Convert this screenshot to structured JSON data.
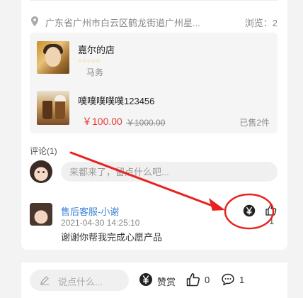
{
  "location": {
    "address": "广东省广州市白云区鹤龙街道广州星...",
    "views": "浏览：2"
  },
  "shop": {
    "name": "嘉尔的店",
    "rating_text": "☆☆☆☆☆",
    "subtitle": "马务"
  },
  "product": {
    "name": "噗噗噗噗噗123456",
    "price": "￥100.00",
    "original_price": "￥1000.00",
    "sold": "已售2件"
  },
  "comments": {
    "title": "评论(1)",
    "input_placeholder": "来都来了，留点什么吧...",
    "items": [
      {
        "author": "售后客服-小谢",
        "time": "2021-04-30 14:25:10",
        "text": "谢谢你帮我完成心愿产品",
        "likes": "1"
      }
    ]
  },
  "bottom_bar": {
    "input_placeholder": "说点什么...",
    "reward_label": "赞赏",
    "like_count": "0",
    "comment_count": "1"
  },
  "icons": {
    "location": "location-pin-icon",
    "tip": "yen-coin-icon",
    "like": "thumbs-up-icon",
    "comment": "speech-bubble-icon",
    "edit": "pencil-icon"
  },
  "colors": {
    "price": "#e53935",
    "author_link": "#3b82d6",
    "annotation": "#e8231f",
    "stars": "#f2b533"
  }
}
